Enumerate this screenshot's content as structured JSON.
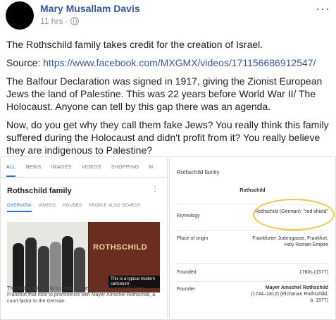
{
  "post": {
    "author": "Mary Musallam Davis",
    "time": "11 hrs ·",
    "paragraph1": "The Rothschild family takes credit for the creation of Israel.",
    "source_label": "Source: ",
    "source_url": "https://www.facebook.com/MXGMX/videos/171156686912547/",
    "paragraph3": "The Balfour Declaration was signed in 1917, giving the Zionist European Jews the land of Palestine. This was 22 years before World War II/ The Holocaust. Anyone can tell by this gap there was an agenda.",
    "paragraph4": "Now, do you get why they call them fake Jews? You really think this family suffered during the Holocaust and didn't profit from it? You really believe they are indigenous to Palestine?"
  },
  "left_image": {
    "tabs": [
      "ALL",
      "NEWS",
      "IMAGES",
      "VIDEOS",
      "SHOPPING",
      "M"
    ],
    "title": "Rothschild family",
    "subtabs": [
      "OVERVIEW",
      "VIDEOS",
      "HOUSES",
      "PEOPLE ALSO SEARCH"
    ],
    "photo_label": "ROTHSCHILD",
    "caption": "This is a typical modern caricature:",
    "description": "The Rothschild family is a wealthy Jewish family originally from Frankfurt that rose to prominence with Mayer Amschel Rothschild, a court factor to the German"
  },
  "right_image": {
    "title": "Rothschild family",
    "subtitle": "Rothschild",
    "rows": [
      {
        "key": "Etymology",
        "value": "Rothschild (German): \"red shield\""
      },
      {
        "key": "Place of origin",
        "value": "Frankfurter Judengasse, Frankfurt, Holy Roman Empire"
      },
      {
        "key": "Founded",
        "value": "1760s (1577)"
      },
      {
        "key": "Founder",
        "value_bold": "Mayer Amschel Rothschild",
        "value": " (1744–1812) (Elchanan Rothschild, b. 1577)"
      }
    ],
    "highlight_color": "#f2c744"
  }
}
